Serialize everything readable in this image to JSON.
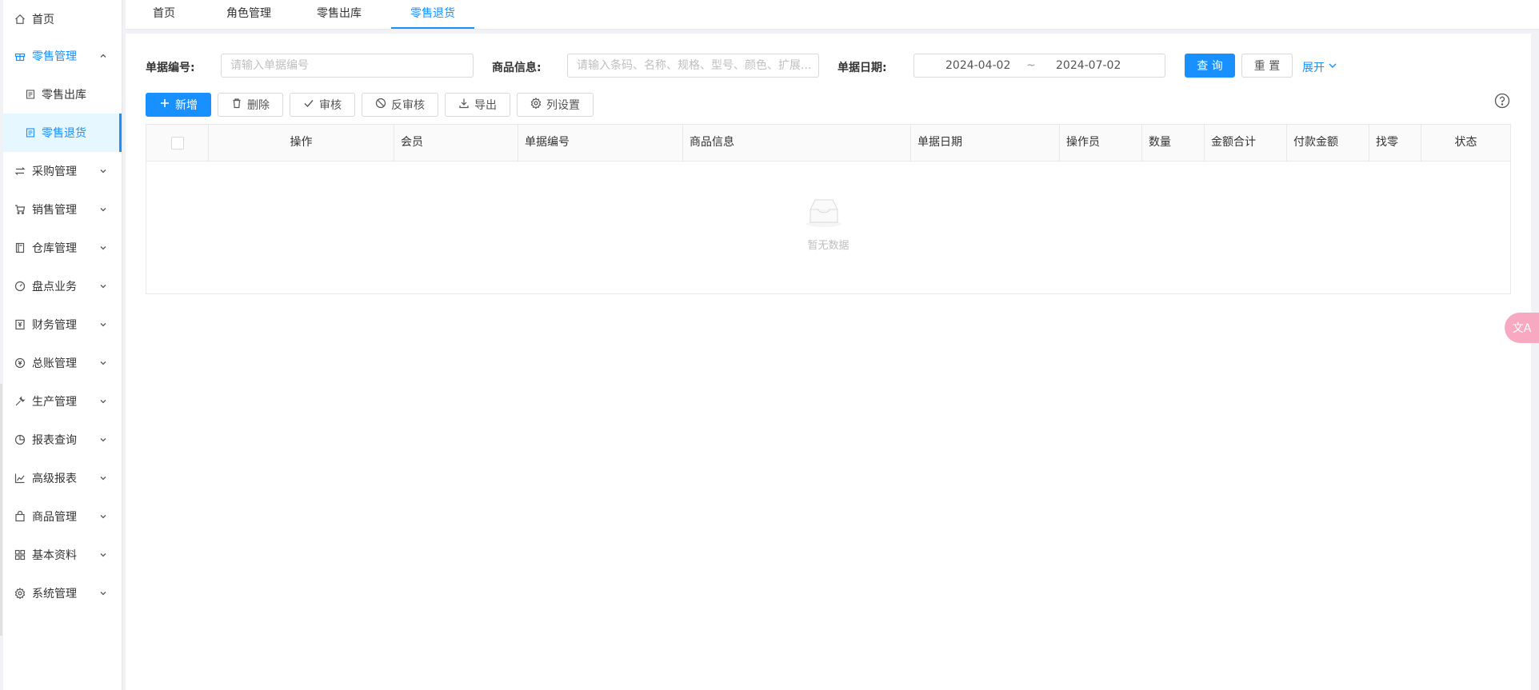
{
  "sidebar": {
    "items": [
      {
        "label": "首页",
        "icon": "home-icon"
      },
      {
        "label": "零售管理",
        "icon": "gift-icon",
        "open": true
      },
      {
        "label": "零售出库",
        "icon": "document-icon",
        "sub": true
      },
      {
        "label": "零售退货",
        "icon": "document-icon",
        "sub": true,
        "active": true
      },
      {
        "label": "采购管理",
        "icon": "swap-icon"
      },
      {
        "label": "销售管理",
        "icon": "cart-icon"
      },
      {
        "label": "仓库管理",
        "icon": "book-icon"
      },
      {
        "label": "盘点业务",
        "icon": "dashboard-icon"
      },
      {
        "label": "财务管理",
        "icon": "account-book-icon"
      },
      {
        "label": "总账管理",
        "icon": "money-icon"
      },
      {
        "label": "生产管理",
        "icon": "tool-icon"
      },
      {
        "label": "报表查询",
        "icon": "pie-chart-icon"
      },
      {
        "label": "高级报表",
        "icon": "line-chart-icon"
      },
      {
        "label": "商品管理",
        "icon": "shopping-icon"
      },
      {
        "label": "基本资料",
        "icon": "appstore-icon"
      },
      {
        "label": "系统管理",
        "icon": "setting-icon"
      }
    ]
  },
  "tabs": [
    {
      "label": "首页"
    },
    {
      "label": "角色管理"
    },
    {
      "label": "零售出库"
    },
    {
      "label": "零售退货",
      "active": true
    }
  ],
  "search": {
    "bill_no_label": "单据编号:",
    "bill_no_placeholder": "请输入单据编号",
    "goods_label": "商品信息:",
    "goods_placeholder": "请输入条码、名称、规格、型号、颜色、扩展...",
    "date_label": "单据日期:",
    "date_start": "2024-04-02",
    "date_sep": "~",
    "date_end": "2024-07-02",
    "query_label": "查 询",
    "reset_label": "重 置",
    "expand_label": "展开"
  },
  "toolbar": {
    "add_label": "新增",
    "delete_label": "删除",
    "audit_label": "审核",
    "unaudit_label": "反审核",
    "export_label": "导出",
    "columns_label": "列设置"
  },
  "table": {
    "columns": [
      "操作",
      "会员",
      "单据编号",
      "商品信息",
      "单据日期",
      "操作员",
      "数量",
      "金额合计",
      "付款金额",
      "找零",
      "状态"
    ],
    "empty_text": "暂无数据"
  },
  "float": {
    "label": "文A"
  },
  "colors": {
    "primary": "#1890ff",
    "active_bg": "#e6f7ff"
  }
}
